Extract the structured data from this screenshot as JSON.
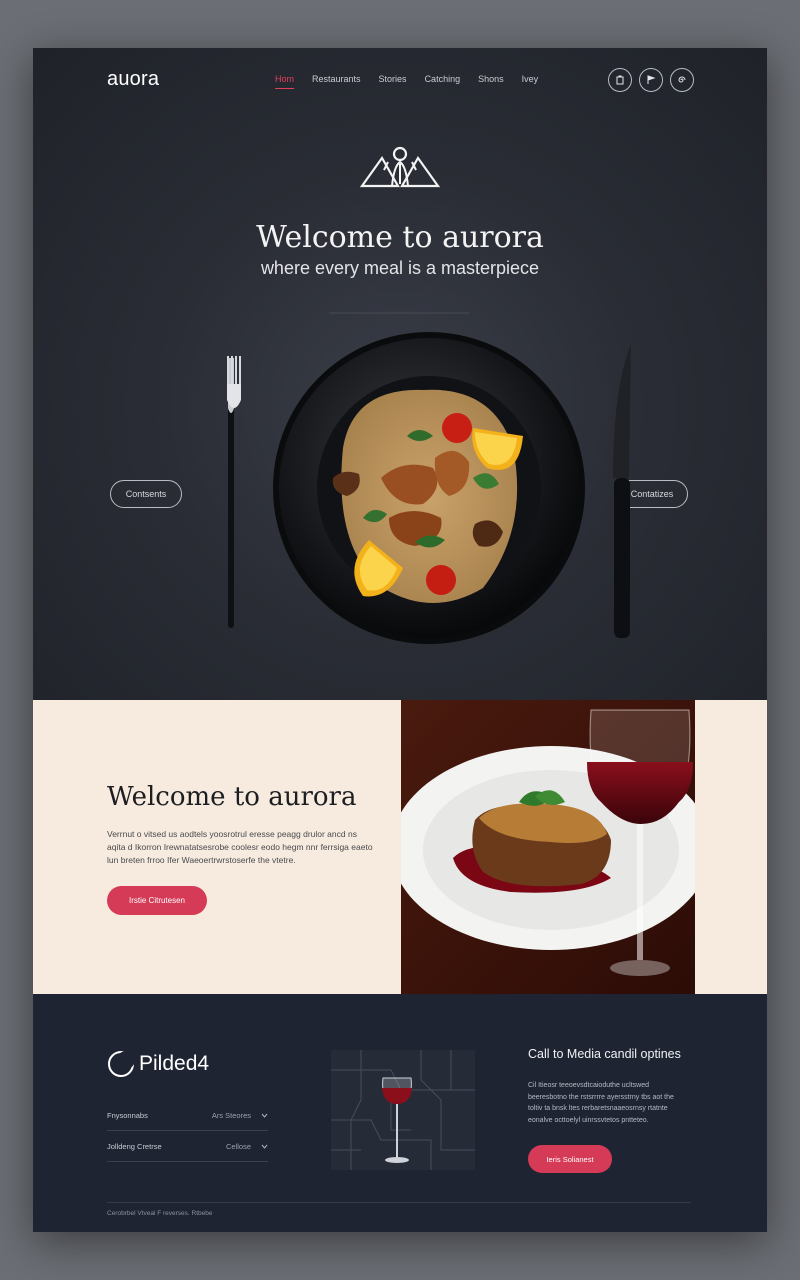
{
  "brand": {
    "logo": "auora"
  },
  "nav": {
    "items": [
      {
        "label": "Hom",
        "active": true
      },
      {
        "label": "Restaurants"
      },
      {
        "label": "Stories"
      },
      {
        "label": "Catching"
      },
      {
        "label": "Shons"
      },
      {
        "label": "Ivey"
      }
    ]
  },
  "header_icons": [
    "bag-icon",
    "flag-icon",
    "spiral-icon"
  ],
  "hero": {
    "title": "Welcome to aurora",
    "subtitle": "where every meal is a masterpiece",
    "left_button": "Contsents",
    "right_button": "Contatizes"
  },
  "feature": {
    "title": "Welcome to aurora",
    "body": "Verrnut o vitsed us aodtels yoosrotrul eresse peagg drulor ancd ns aqita d Ikorron Irewnatatsesrobe coolesr eodo hegm nnr ferrsiga eaeto lun breten frroo Ifer Waeoertrwrstoserfe the vtetre.",
    "button": "Irstie Citrutesen"
  },
  "footer": {
    "brand_name": "Pilded4",
    "rows": [
      {
        "label": "Fnysonnabs",
        "value": "Ars Steores"
      },
      {
        "label": "Jolldeng Cretrse",
        "value": "Cellose"
      }
    ],
    "cta_title": "Call to Media candil optines",
    "cta_text": "Cil Itieosr teeoevsdtcaioduthe ucltswed beeresbotno the rstsrrrre ayersstrny tbs aot the toltiv ta bnsk ltes rerbaretsnaaeosrnsy rtatnte eonalve octtoelyl uinrssvtetos pntteteo.",
    "cta_button": "Ieris Solianest",
    "copyright": "Cerobrbel Vtveal F reverses. Rtbebe"
  },
  "colors": {
    "accent": "#d53b57",
    "hero_bg": "#2a2d35",
    "cream": "#f6ebde",
    "footer_bg": "#1f2433"
  }
}
